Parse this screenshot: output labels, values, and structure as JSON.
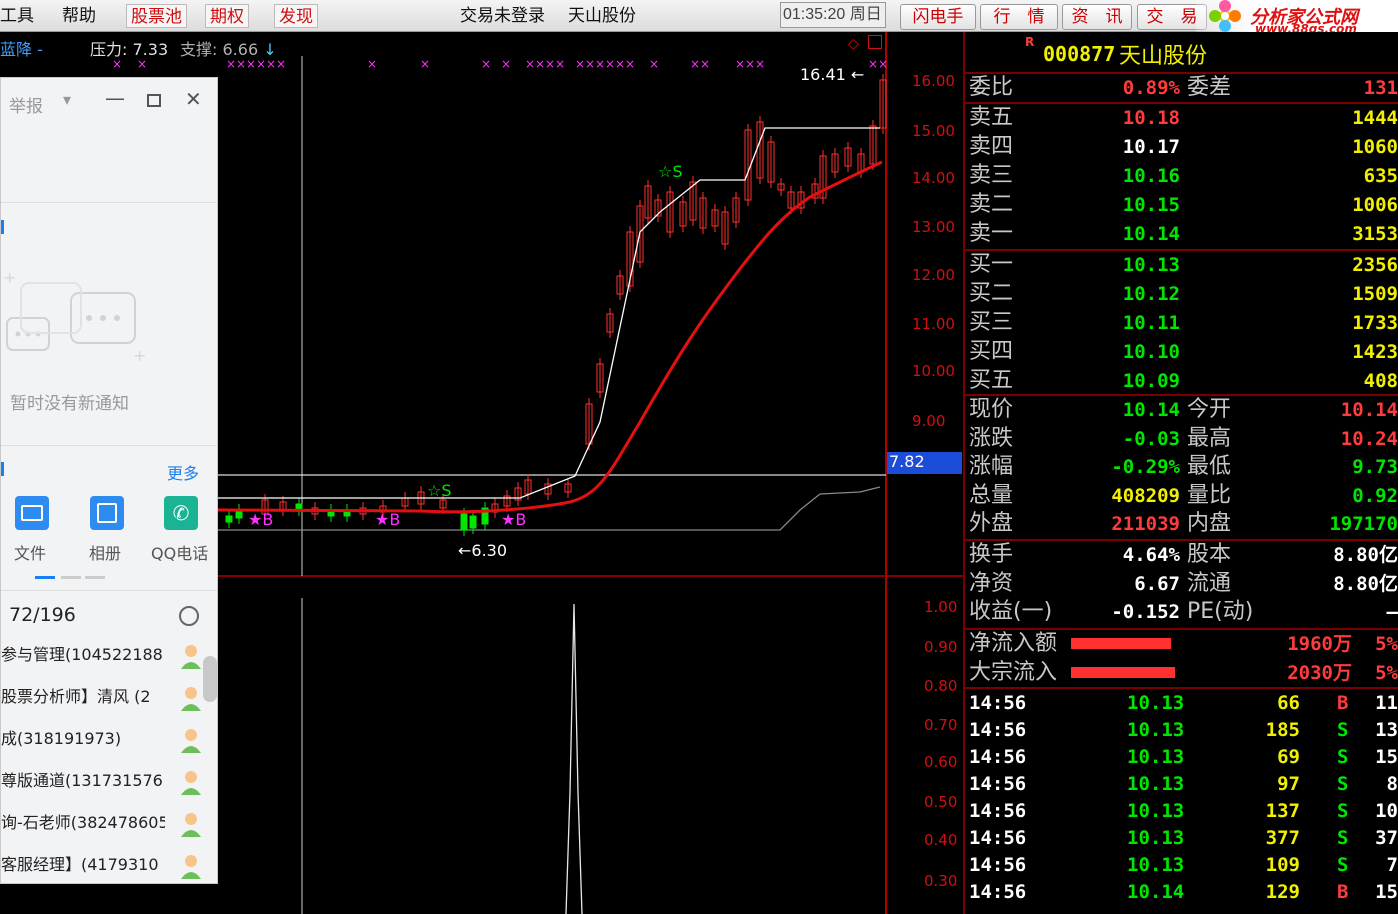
{
  "menu": {
    "tools": "工具",
    "help": "帮助",
    "stock_pool": "股票池",
    "options": "期权",
    "discover": "发现"
  },
  "title": {
    "login_status": "交易未登录",
    "stock_name": "天山股份"
  },
  "clock": {
    "time": "01:35:20",
    "weekday": "周日"
  },
  "tabs": [
    "闪电手",
    "行　情",
    "资　讯",
    "交　易"
  ],
  "logo": {
    "name": "分析家公式网",
    "url": "www.88gs.com"
  },
  "indicator": {
    "prefix": "蓝降",
    "dash": "-",
    "pressure_label": "压力:",
    "pressure": "7.33",
    "support_label": "支撑:",
    "support": "6.66"
  },
  "price_axis": [
    "16.00",
    "15.00",
    "14.00",
    "13.00",
    "12.00",
    "11.00",
    "10.00",
    "9.00"
  ],
  "sub_axis": [
    "1.00",
    "0.90",
    "0.80",
    "0.70",
    "0.60",
    "0.50",
    "0.40",
    "0.30"
  ],
  "price_marker": "7.82",
  "annotations": {
    "high": "16.41",
    "low": "6.30",
    "buy": "B",
    "sell": "S"
  },
  "popup": {
    "title": "举报",
    "empty_notice": "暂时没有新通知",
    "more": "更多",
    "actions": [
      "文件",
      "相册",
      "QQ电话"
    ],
    "count": "72/196",
    "contacts": [
      "参与管理(104522188",
      "股票分析师】清风 (2",
      "成(318191973)",
      "尊版通道(131731576",
      "询-石老师(382478605",
      "客服经理】(4179310"
    ]
  },
  "panel": {
    "code": "000877",
    "name": "天山股份",
    "r_mark": "R",
    "wei": {
      "ratio_label": "委比",
      "ratio": "0.89%",
      "diff_label": "委差",
      "diff": "131"
    },
    "asks": [
      {
        "label": "卖五",
        "price": "10.18",
        "vol": "1444"
      },
      {
        "label": "卖四",
        "price": "10.17",
        "vol": "1060"
      },
      {
        "label": "卖三",
        "price": "10.16",
        "vol": "635"
      },
      {
        "label": "卖二",
        "price": "10.15",
        "vol": "1006"
      },
      {
        "label": "卖一",
        "price": "10.14",
        "vol": "3153"
      }
    ],
    "bids": [
      {
        "label": "买一",
        "price": "10.13",
        "vol": "2356"
      },
      {
        "label": "买二",
        "price": "10.12",
        "vol": "1509"
      },
      {
        "label": "买三",
        "price": "10.11",
        "vol": "1733"
      },
      {
        "label": "买四",
        "price": "10.10",
        "vol": "1423"
      },
      {
        "label": "买五",
        "price": "10.09",
        "vol": "408"
      }
    ],
    "quote": [
      {
        "k": "现价",
        "v": "10.14",
        "k2": "今开",
        "v2": "10.14"
      },
      {
        "k": "涨跌",
        "v": "-0.03",
        "k2": "最高",
        "v2": "10.24"
      },
      {
        "k": "涨幅",
        "v": "-0.29%",
        "k2": "最低",
        "v2": "9.73"
      },
      {
        "k": "总量",
        "v": "408209",
        "k2": "量比",
        "v2": "0.92"
      },
      {
        "k": "外盘",
        "v": "211039",
        "k2": "内盘",
        "v2": "197170"
      }
    ],
    "finance": [
      {
        "k": "换手",
        "v": "4.64%",
        "k2": "股本",
        "v2": "8.80亿"
      },
      {
        "k": "净资",
        "v": "6.67",
        "k2": "流通",
        "v2": "8.80亿"
      },
      {
        "k": "收益(一)",
        "v": "-0.152",
        "k2": "PE(动)",
        "v2": "—"
      }
    ],
    "flows": [
      {
        "k": "净流入额",
        "v": "1960万",
        "pct": "5%"
      },
      {
        "k": "大宗流入",
        "v": "2030万",
        "pct": "5%"
      }
    ],
    "ticks": [
      {
        "t": "14:56",
        "p": "10.13",
        "v": "66",
        "d": "B",
        "n": "11"
      },
      {
        "t": "14:56",
        "p": "10.13",
        "v": "185",
        "d": "S",
        "n": "13"
      },
      {
        "t": "14:56",
        "p": "10.13",
        "v": "69",
        "d": "S",
        "n": "15"
      },
      {
        "t": "14:56",
        "p": "10.13",
        "v": "97",
        "d": "S",
        "n": "8"
      },
      {
        "t": "14:56",
        "p": "10.13",
        "v": "137",
        "d": "S",
        "n": "10"
      },
      {
        "t": "14:56",
        "p": "10.13",
        "v": "377",
        "d": "S",
        "n": "37"
      },
      {
        "t": "14:56",
        "p": "10.13",
        "v": "109",
        "d": "S",
        "n": "7"
      },
      {
        "t": "14:56",
        "p": "10.14",
        "v": "129",
        "d": "B",
        "n": "15"
      }
    ]
  },
  "colors": {
    "up": "#ff3b3b",
    "down": "#00e600",
    "border": "#7a0000",
    "accent_red": "#d01010"
  }
}
